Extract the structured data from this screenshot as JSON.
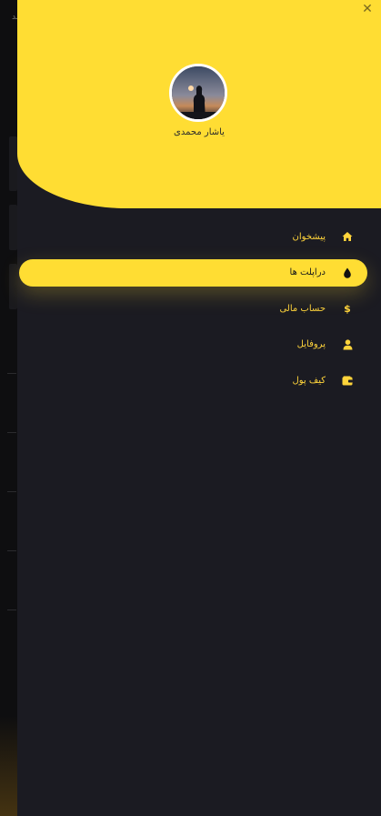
{
  "drawer": {
    "close_icon": "close-icon",
    "user_name": "یاشار محمدی"
  },
  "menu": {
    "items": [
      {
        "label": "پیشخوان",
        "icon": "home-icon",
        "active": false
      },
      {
        "label": "دراپلت ها",
        "icon": "droplet-icon",
        "active": true
      },
      {
        "label": "حساب مالی",
        "icon": "dollar-icon",
        "active": false
      },
      {
        "label": "پروفایل",
        "icon": "user-icon",
        "active": false
      },
      {
        "label": "کیف پول",
        "icon": "wallet-icon",
        "active": false
      }
    ]
  },
  "colors": {
    "accent": "#ffdd33",
    "drawer_bg": "#1b1b22",
    "menu_text": "#ffd43b"
  }
}
